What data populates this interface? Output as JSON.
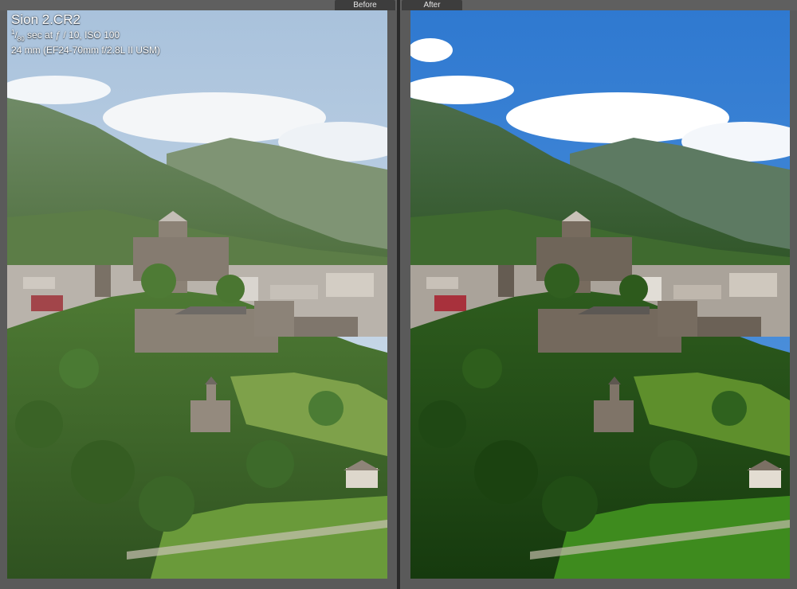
{
  "compare": {
    "before_label": "Before",
    "after_label": "After"
  },
  "metadata": {
    "filename": "Sion 2.CR2",
    "shutter_numerator": "1",
    "shutter_denominator": "80",
    "exposure_rest": " sec at ƒ / 10, ISO 100",
    "lens_line": "24 mm (EF24-70mm f/2.8L II USM)"
  },
  "colors": {
    "before_sky": "#b9cde0",
    "after_sky": "#3f86d6",
    "before_foliage": "#3f6a2c",
    "after_foliage": "#1f4a14",
    "castle_stone": "#7d746a"
  }
}
